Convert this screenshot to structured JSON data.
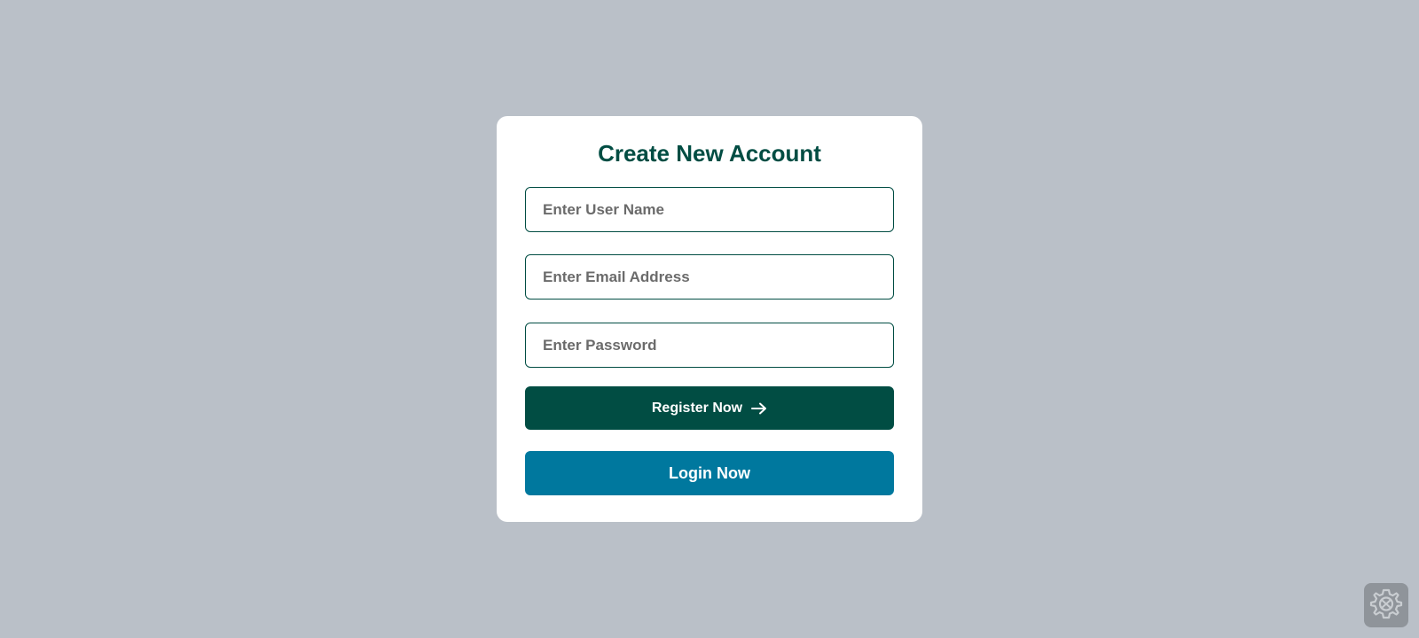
{
  "form": {
    "title": "Create New Account",
    "username_placeholder": "Enter User Name",
    "email_placeholder": "Enter Email Address",
    "password_placeholder": "Enter Password",
    "register_label": "Register Now",
    "login_label": "Login Now"
  },
  "icons": {
    "register_arrow": "arrow-right-icon",
    "settings": "gear-icon"
  },
  "colors": {
    "background": "#bac0c8",
    "card": "#ffffff",
    "primary": "#014d43",
    "login_button": "#00789e",
    "settings_button": "#8f949a"
  }
}
